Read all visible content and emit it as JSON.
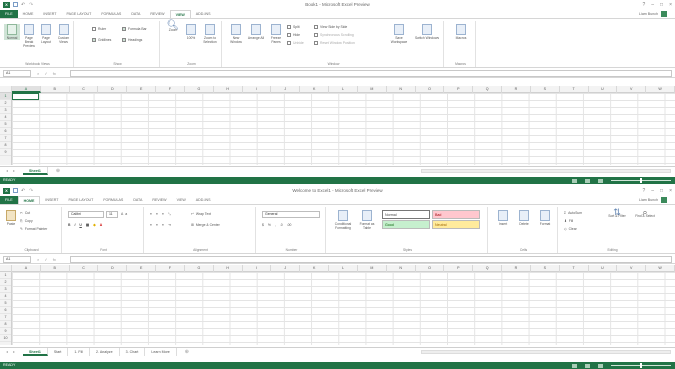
{
  "w1": {
    "title": "Book1 - Microsoft Excel Preview",
    "user": "Liam Bunch",
    "tabs": [
      "FILE",
      "HOME",
      "INSERT",
      "PAGE LAYOUT",
      "FORMULAS",
      "DATA",
      "REVIEW",
      "VIEW",
      "ADD-INS"
    ],
    "active_tab": "VIEW",
    "ribbon": {
      "workbook_views": {
        "label": "Workbook Views",
        "buttons": [
          "Normal",
          "Page Break Preview",
          "Page Layout",
          "Custom Views"
        ]
      },
      "show": {
        "label": "Show",
        "items": [
          "Ruler",
          "Formula Bar",
          "Gridlines",
          "Headings"
        ]
      },
      "zoom": {
        "label": "Zoom",
        "buttons": [
          "Zoom",
          "100%",
          "Zoom to Selection"
        ]
      },
      "window": {
        "label": "Window",
        "buttons": [
          "New Window",
          "Arrange All",
          "Freeze Panes"
        ],
        "small": [
          "Split",
          "Hide",
          "Unhide"
        ],
        "side": [
          "View Side by Side",
          "Synchronous Scrolling",
          "Reset Window Position"
        ],
        "switch": [
          "Save Workspace",
          "Switch Windows"
        ]
      },
      "macros": {
        "label": "Macros",
        "button": "Macros"
      }
    },
    "name_box": "A1",
    "columns": [
      "A",
      "B",
      "C",
      "D",
      "E",
      "F",
      "G",
      "H",
      "I",
      "J",
      "K",
      "L",
      "M",
      "N",
      "O",
      "P",
      "Q",
      "R",
      "S",
      "T",
      "U",
      "V",
      "W"
    ],
    "rows": [
      "1",
      "2",
      "3",
      "4",
      "5",
      "6",
      "7",
      "8",
      "9"
    ],
    "sheets": [
      "Sheet1"
    ],
    "status": "READY"
  },
  "w2": {
    "title": "Welcome to Excel1 - Microsoft Excel Preview",
    "user": "Liam Bunch",
    "tabs": [
      "FILE",
      "HOME",
      "INSERT",
      "PAGE LAYOUT",
      "FORMULAS",
      "DATA",
      "REVIEW",
      "VIEW",
      "ADD-INS"
    ],
    "active_tab": "HOME",
    "ribbon": {
      "clipboard": {
        "label": "Clipboard",
        "paste": "Paste",
        "items": [
          "Cut",
          "Copy",
          "Format Painter"
        ]
      },
      "font": {
        "label": "Font",
        "name": "Calibri",
        "size": "11"
      },
      "alignment": {
        "label": "Alignment",
        "wrap": "Wrap Text",
        "merge": "Merge & Center"
      },
      "number": {
        "label": "Number",
        "format": "General"
      },
      "styles": {
        "label": "Styles",
        "cond": "Conditional Formatting",
        "table": "Format as Table",
        "cells": [
          "Normal",
          "Bad",
          "Good",
          "Neutral"
        ]
      },
      "cells": {
        "label": "Cells",
        "buttons": [
          "Insert",
          "Delete",
          "Format"
        ]
      },
      "editing": {
        "label": "Editing",
        "items": [
          "AutoSum",
          "Fill",
          "Clear"
        ],
        "sort": "Sort & Filter",
        "find": "Find & Select"
      }
    },
    "name_box": "A1",
    "columns": [
      "A",
      "B",
      "C",
      "D",
      "E",
      "F",
      "G",
      "H",
      "I",
      "J",
      "K",
      "L",
      "M",
      "N",
      "O",
      "P",
      "Q",
      "R",
      "S",
      "T",
      "U",
      "V",
      "W"
    ],
    "rows": [
      "1",
      "2",
      "3",
      "4",
      "5",
      "6",
      "7",
      "8",
      "9",
      "10"
    ],
    "sheets": [
      "Sheet1",
      "Start",
      "1. Fill",
      "2. Analyze",
      "3. Chart",
      "Learn More"
    ],
    "status": "READY"
  },
  "colors": {
    "excel_green": "#217346",
    "style_bad": "#ffc7ce",
    "style_good": "#c6efce",
    "style_neutral": "#ffeb9c"
  },
  "icons": [
    "excel-icon",
    "save-icon",
    "undo-icon",
    "redo-icon",
    "close-icon",
    "minimize-icon",
    "maximize-icon",
    "help-icon"
  ]
}
